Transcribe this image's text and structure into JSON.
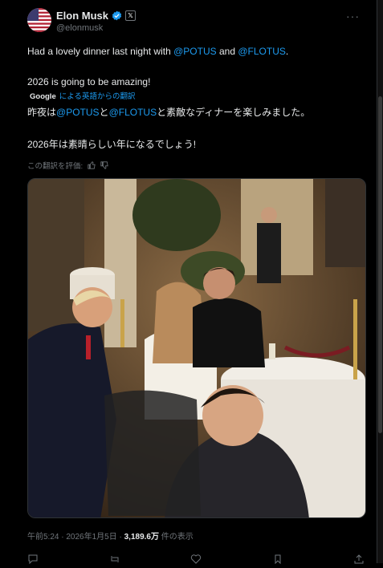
{
  "author": {
    "name": "Elon Musk",
    "handle": "@elonmusk",
    "verified_icon": "verified-badge-icon",
    "affiliation_icon": "x-logo-badge-icon",
    "affiliation_label": "𝕏"
  },
  "more_label": "···",
  "post": {
    "line1_prefix": "Had a lovely dinner last night with ",
    "mention1": "@POTUS",
    "line1_mid": " and ",
    "mention2": "@FLOTUS",
    "line1_suffix": ".",
    "line2": "2026 is going to be amazing!"
  },
  "translation": {
    "provider": "Google",
    "label": "による英語からの翻訳",
    "line1_mention1": "@POTUS",
    "line1_mid": "と",
    "line1_mention2": "@FLOTUS",
    "line1_suffix": "と素敵なディナーを楽しみました。",
    "line1_prefix": "昨夜は",
    "line2": "2026年は素晴らしい年になるでしょう!",
    "rate_label": "この翻訳を評価:"
  },
  "meta": {
    "time": "午前5:24 · 2026年1月5日 · ",
    "views": "3,189.6万",
    "views_label": " 件の表示"
  },
  "colors": {
    "background": "#000000",
    "text": "#e7e9ea",
    "secondary": "#71767b",
    "link": "#1d9bf0",
    "verified": "#1d9bf0"
  }
}
